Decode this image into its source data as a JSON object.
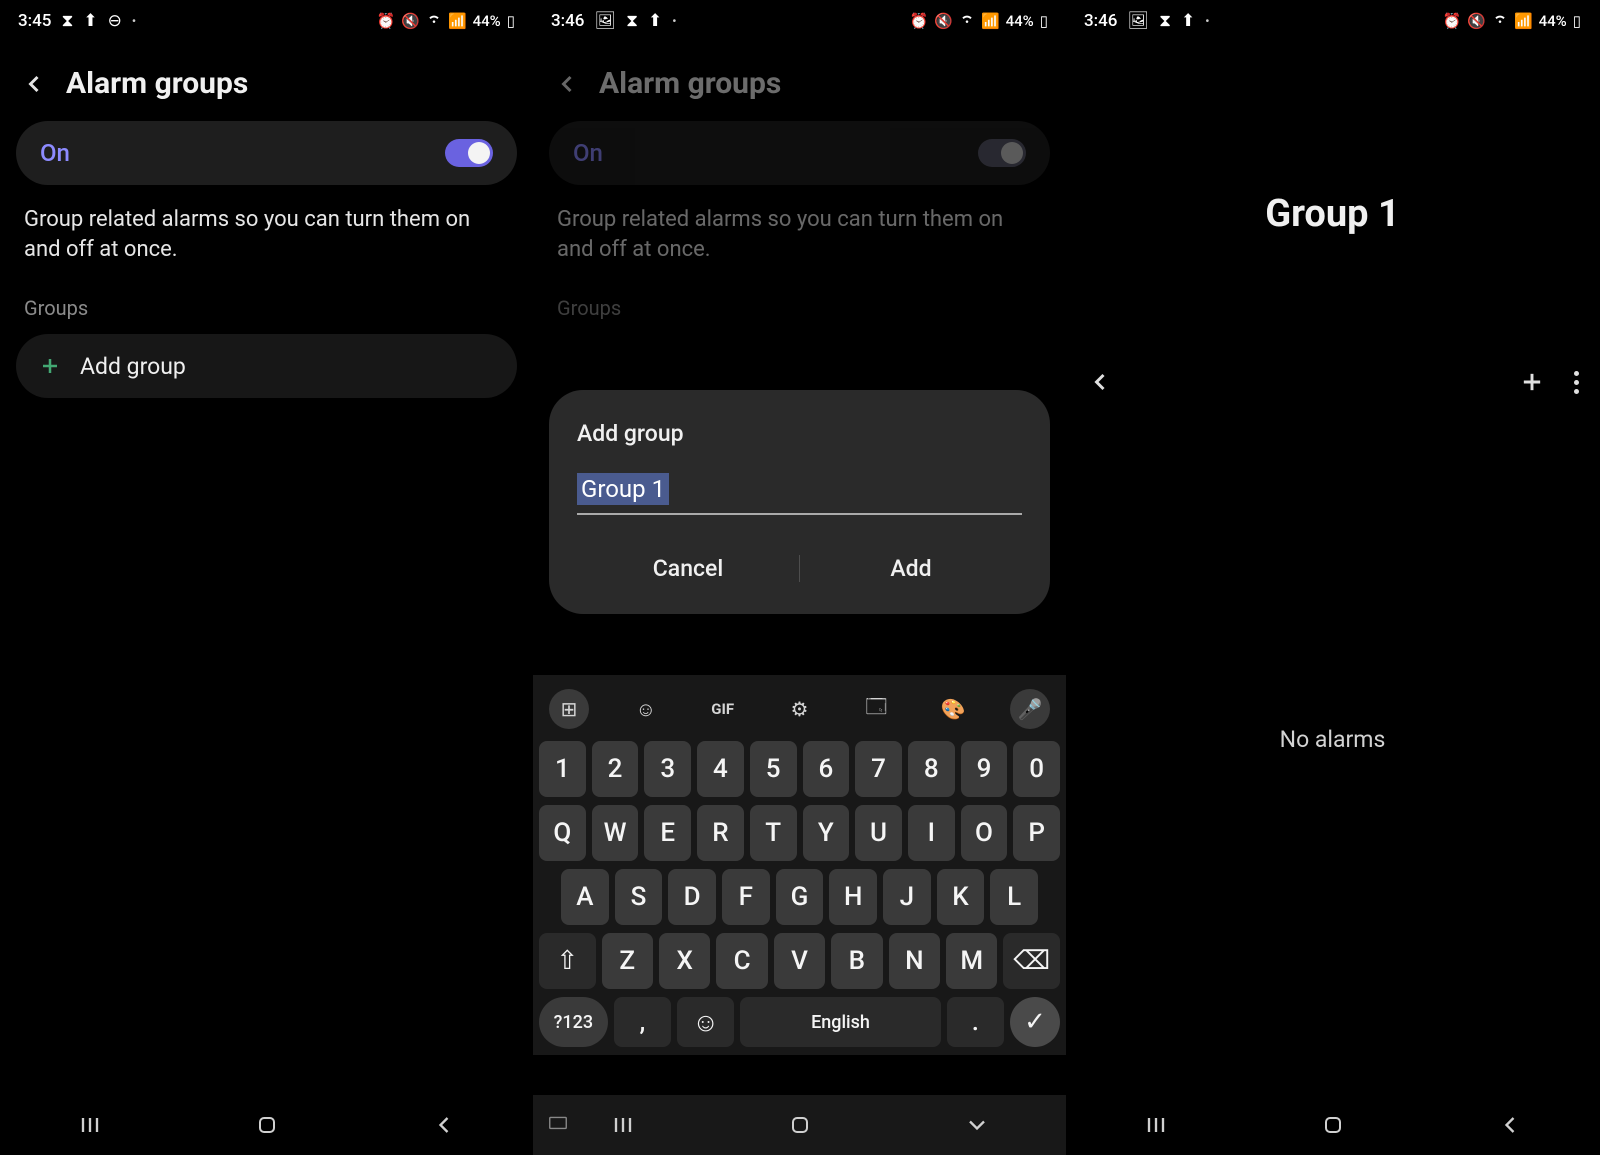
{
  "status": {
    "time1": "3:45",
    "time2": "3:46",
    "time3": "3:46",
    "battery": "44%"
  },
  "screen1": {
    "title": "Alarm groups",
    "toggle_label": "On",
    "description": "Group related alarms so you can turn them on and off at once.",
    "section": "Groups",
    "add_group": "Add group"
  },
  "screen2": {
    "title": "Alarm groups",
    "toggle_label": "On",
    "description": "Group related alarms so you can turn them on and off at once.",
    "section": "Groups",
    "dialog": {
      "title": "Add group",
      "input_value": "Group 1",
      "cancel": "Cancel",
      "add": "Add"
    },
    "keyboard": {
      "gif": "GIF",
      "row1": [
        "1",
        "2",
        "3",
        "4",
        "5",
        "6",
        "7",
        "8",
        "9",
        "0"
      ],
      "row2": [
        "Q",
        "W",
        "E",
        "R",
        "T",
        "Y",
        "U",
        "I",
        "O",
        "P"
      ],
      "row3": [
        "A",
        "S",
        "D",
        "F",
        "G",
        "H",
        "J",
        "K",
        "L"
      ],
      "row4": [
        "Z",
        "X",
        "C",
        "V",
        "B",
        "N",
        "M"
      ],
      "sym": "?123",
      "lang": "English"
    }
  },
  "screen3": {
    "title": "Group 1",
    "empty": "No alarms"
  }
}
